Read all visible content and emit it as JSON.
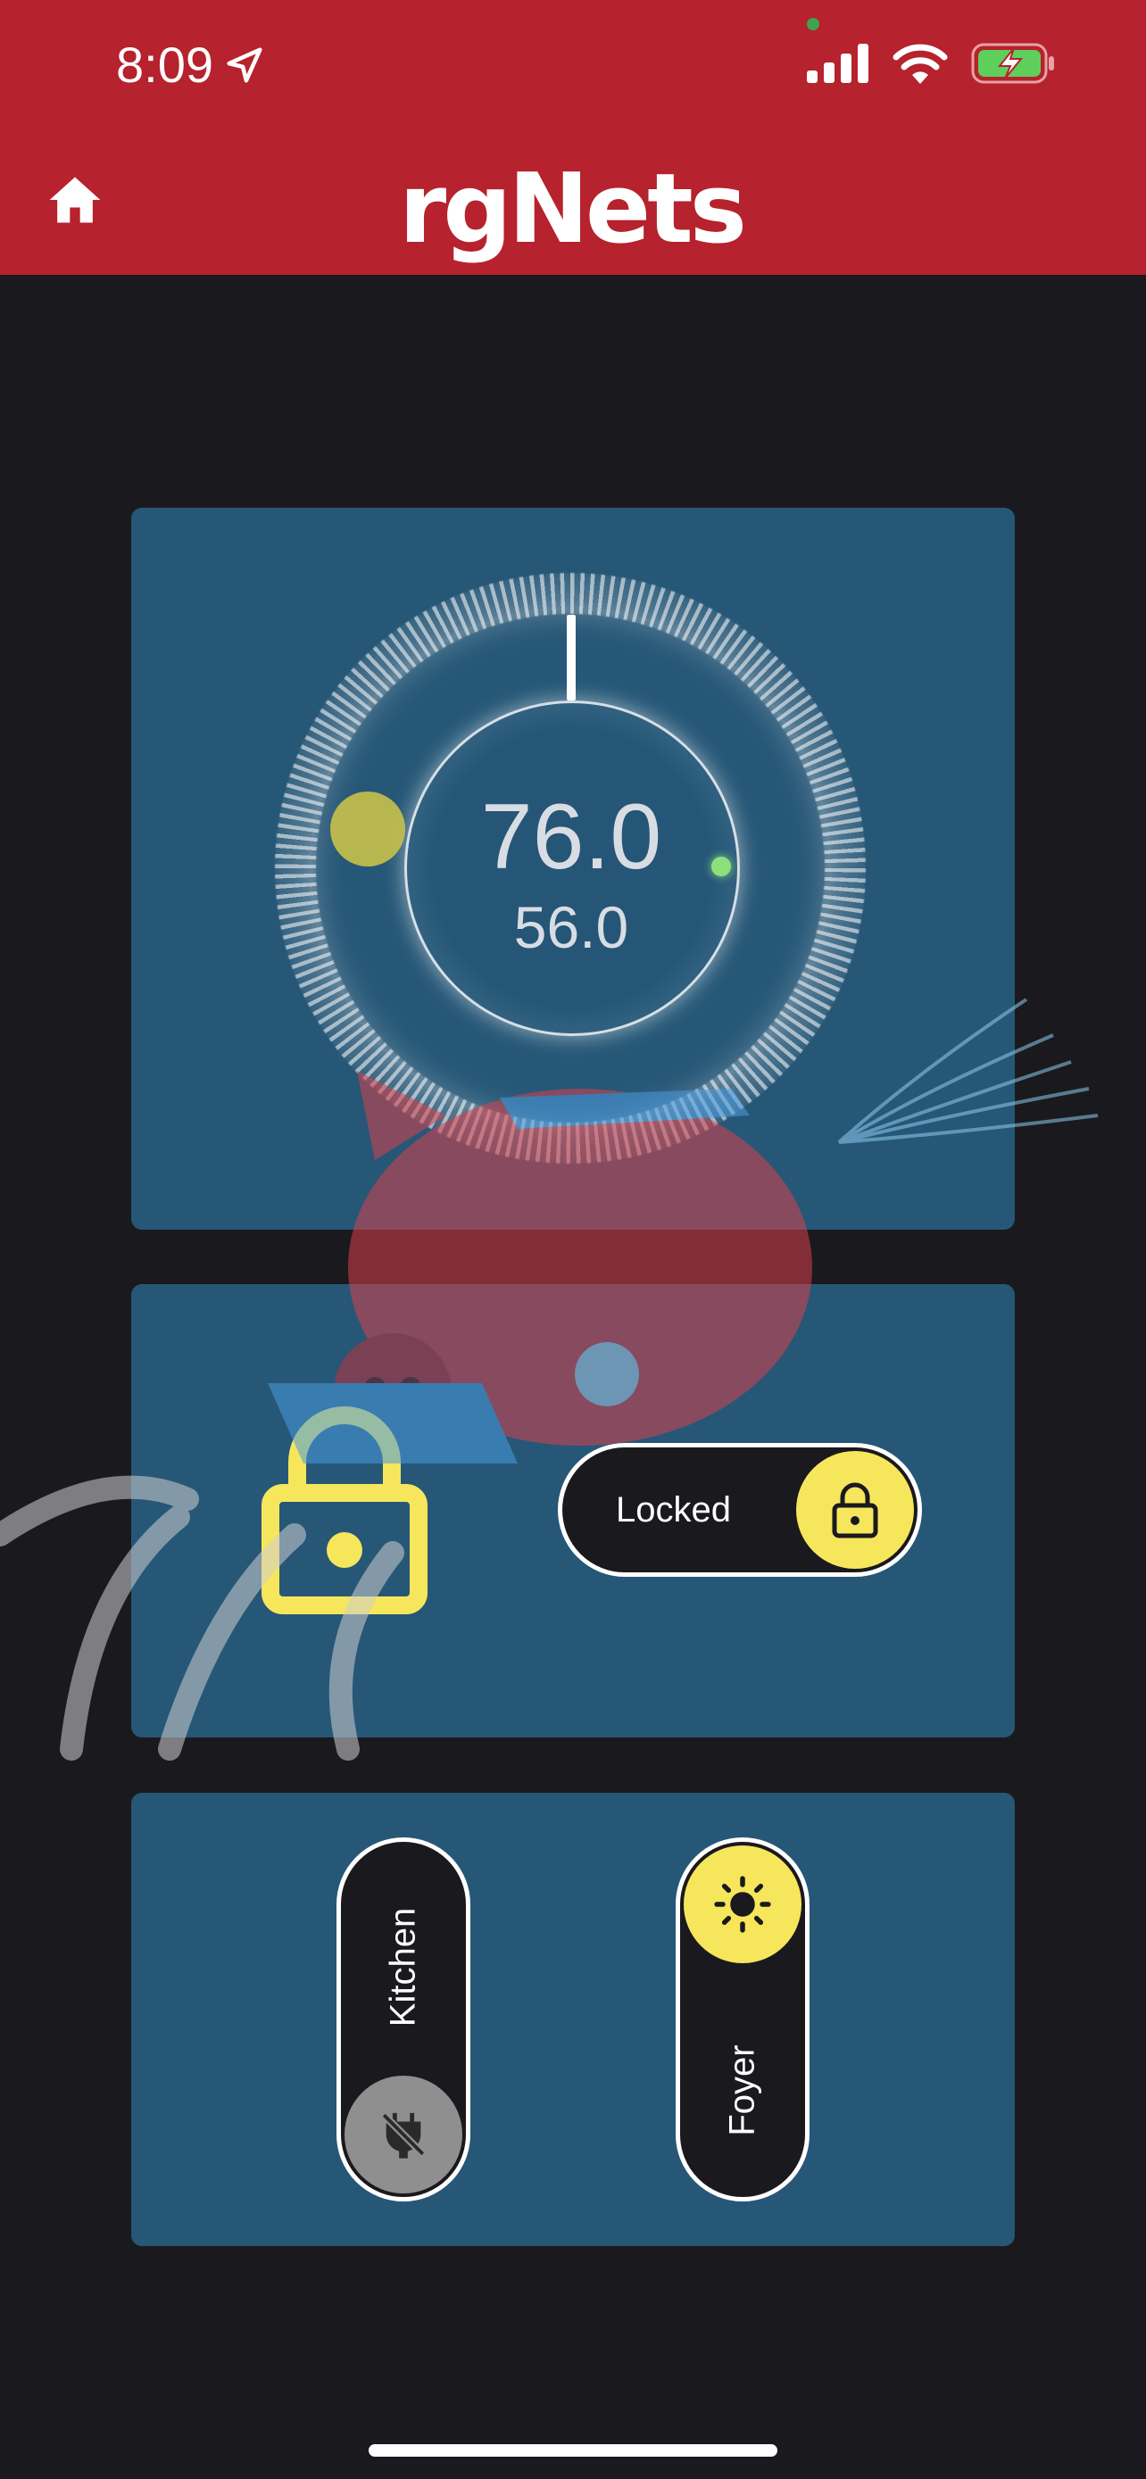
{
  "status_bar": {
    "time": "8:09"
  },
  "header": {
    "brand": "rgNets"
  },
  "thermostat": {
    "setpoint": "76.0",
    "current": "56.0"
  },
  "lock": {
    "state_label": "Locked"
  },
  "lights": [
    {
      "label": "Kitchen",
      "state": "off"
    },
    {
      "label": "Foyer",
      "state": "on"
    }
  ],
  "colors": {
    "header_red": "#b6222d",
    "panel_blue": "#265777",
    "accent_yellow": "#f6e65b",
    "background": "#1a191e"
  },
  "icons": [
    "location-arrow-icon",
    "signal-icon",
    "wifi-icon",
    "battery-charging-icon",
    "home-icon",
    "padlock-icon",
    "plug-off-icon",
    "sun-icon"
  ]
}
